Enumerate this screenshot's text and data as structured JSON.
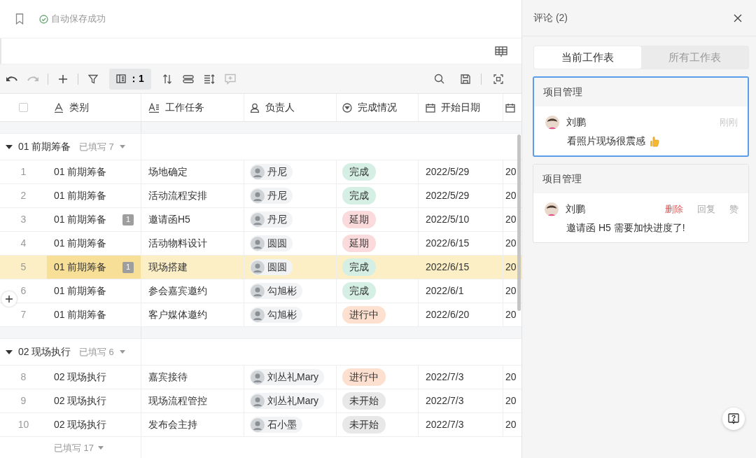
{
  "topbar": {
    "save_status": "自动保存成功"
  },
  "toolbar": {
    "hidden_fields": "：1"
  },
  "select_all": {
    "checked": false
  },
  "columns": [
    {
      "label": "类别",
      "kind": "text"
    },
    {
      "label": "工作任务",
      "kind": "longtext"
    },
    {
      "label": "负责人",
      "kind": "person"
    },
    {
      "label": "完成情况",
      "kind": "select"
    },
    {
      "label": "开始日期",
      "kind": "date"
    },
    {
      "kind": "date"
    }
  ],
  "groups": [
    {
      "title": "01 前期筹备",
      "count_label": "已填写 7",
      "expanded": true,
      "rows": [
        {
          "number": "1",
          "category": "01 前期筹备",
          "task": "场地确定",
          "owner": "丹尼",
          "status": {
            "label": "完成",
            "color": "#d6efe4"
          },
          "start_date": "2022/5/29",
          "column_7": "20",
          "selected": false
        },
        {
          "number": "2",
          "category": "01 前期筹备",
          "task": "活动流程安排",
          "owner": "丹尼",
          "status": {
            "label": "完成",
            "color": "#d6efe4"
          },
          "start_date": "2022/5/29",
          "column_7": "20",
          "selected": false
        },
        {
          "number": "3",
          "category": "01 前期筹备",
          "comments": "1",
          "task": "邀请函H5",
          "owner": "丹尼",
          "status": {
            "label": "延期",
            "color": "#fadadb"
          },
          "start_date": "2022/5/10",
          "column_7": "20",
          "selected": false
        },
        {
          "number": "4",
          "category": "01 前期筹备",
          "task": "活动物料设计",
          "owner": "圆圆",
          "status": {
            "label": "延期",
            "color": "#fadadb"
          },
          "start_date": "2022/6/15",
          "column_7": "20",
          "selected": false
        },
        {
          "number": "5",
          "category": "01 前期筹备",
          "comments": "1",
          "task": "现场搭建",
          "owner": "圆圆",
          "status": {
            "label": "完成",
            "color": "#d6efe4"
          },
          "start_date": "2022/6/15",
          "column_7": "20",
          "selected": true
        },
        {
          "number": "6",
          "category": "01 前期筹备",
          "task": "参会嘉宾邀约",
          "owner": "勾旭彬",
          "status": {
            "label": "完成",
            "color": "#d6efe4"
          },
          "start_date": "2022/6/1",
          "column_7": "20",
          "selected": false
        },
        {
          "number": "7",
          "category": "01 前期筹备",
          "task": "客户媒体邀约",
          "owner": "勾旭彬",
          "status": {
            "label": "进行中",
            "color": "#fde0cf"
          },
          "start_date": "2022/6/20",
          "column_7": "20",
          "selected": false
        }
      ]
    },
    {
      "title": "02 现场执行",
      "count_label": "已填写 6",
      "expanded": true,
      "rows": [
        {
          "number": "8",
          "category": "02 现场执行",
          "task": "嘉宾接待",
          "owner": "刘丛礼Mary",
          "status": {
            "label": "进行中",
            "color": "#fde0cf"
          },
          "start_date": "2022/7/3",
          "column_7": "20",
          "selected": false
        },
        {
          "number": "9",
          "category": "02 现场执行",
          "task": "现场流程管控",
          "owner": "刘丛礼Mary",
          "status": {
            "label": "未开始",
            "color": "#e8e8e8"
          },
          "start_date": "2022/7/3",
          "column_7": "20",
          "selected": false
        },
        {
          "number": "10",
          "category": "02 现场执行",
          "task": "发布会主持",
          "owner": "石小墨",
          "status": {
            "label": "未开始",
            "color": "#e8e8e8"
          },
          "start_date": "2022/7/3",
          "column_7": "20",
          "selected": false
        }
      ]
    }
  ],
  "footer": {
    "count_label": "已填写 17"
  },
  "comments_panel": {
    "title": "评论 (2)",
    "tabs": [
      {
        "label": "当前工作表",
        "selected": true
      },
      {
        "label": "所有工作表",
        "selected": false
      }
    ],
    "comments": [
      {
        "sheet": "项目管理",
        "author": "刘鹏",
        "time": "刚刚",
        "text": "看照片现场很震感",
        "thumbs_up": true,
        "selected": true
      },
      {
        "sheet": "项目管理",
        "author": "刘鹏",
        "actions": [
          {
            "label": "删除",
            "kind": "danger"
          },
          {
            "label": "回复",
            "kind": "normal"
          },
          {
            "label": "赞",
            "kind": "normal"
          }
        ],
        "text": "邀请函 H5 需要加快进度了!",
        "thumbs_up": false,
        "selected": false
      }
    ]
  }
}
